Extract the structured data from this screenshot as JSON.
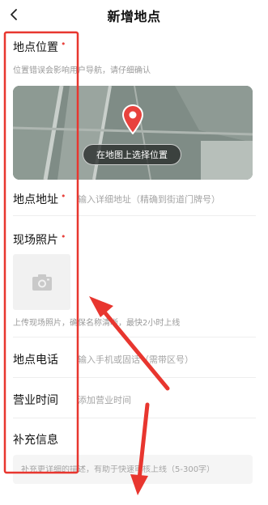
{
  "header": {
    "title": "新增地点",
    "back_icon": "chevron-left-icon"
  },
  "location": {
    "label": "地点位置",
    "required_mark": "•",
    "hint": "位置错误会影响用户导航，请仔细确认",
    "map_button": "在地图上选择位置"
  },
  "address": {
    "label": "地点地址",
    "required_mark": "•",
    "placeholder": "输入详细地址（精确到街道门牌号）"
  },
  "photo": {
    "label": "现场照片",
    "required_mark": "•",
    "camera_icon": "camera-icon",
    "hint": "上传现场照片，确保名称清晰，最快2小时上线"
  },
  "phone": {
    "label": "地点电话",
    "placeholder": "输入手机或固话（需带区号）"
  },
  "hours": {
    "label": "营业时间",
    "placeholder": "添加营业时间"
  },
  "extra": {
    "label": "补充信息",
    "placeholder": "补充更详细的描述，有助于快速审核上线（5-300字）"
  },
  "annotations": {
    "highlight_color": "#e8362f",
    "arrow_color": "#e8362f"
  },
  "colors": {
    "required": "#e8423d",
    "pin": "#e8423d",
    "map_base": "#7f8c86"
  }
}
